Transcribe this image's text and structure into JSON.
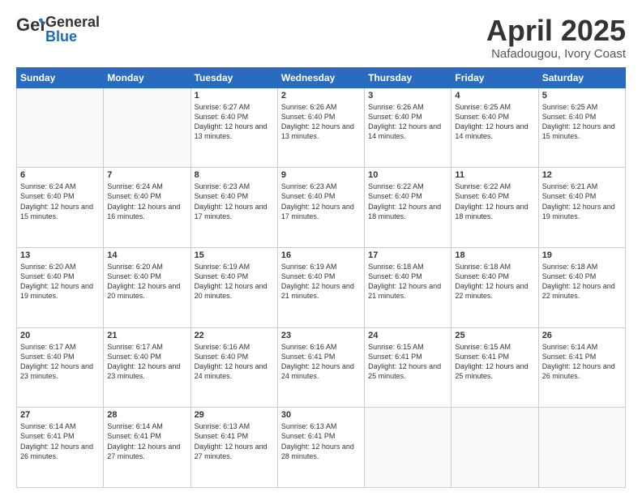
{
  "header": {
    "logo_general": "General",
    "logo_blue": "Blue",
    "month_title": "April 2025",
    "location": "Nafadougou, Ivory Coast"
  },
  "weekdays": [
    "Sunday",
    "Monday",
    "Tuesday",
    "Wednesday",
    "Thursday",
    "Friday",
    "Saturday"
  ],
  "weeks": [
    [
      {
        "day": "",
        "info": ""
      },
      {
        "day": "",
        "info": ""
      },
      {
        "day": "1",
        "info": "Sunrise: 6:27 AM\nSunset: 6:40 PM\nDaylight: 12 hours and 13 minutes."
      },
      {
        "day": "2",
        "info": "Sunrise: 6:26 AM\nSunset: 6:40 PM\nDaylight: 12 hours and 13 minutes."
      },
      {
        "day": "3",
        "info": "Sunrise: 6:26 AM\nSunset: 6:40 PM\nDaylight: 12 hours and 14 minutes."
      },
      {
        "day": "4",
        "info": "Sunrise: 6:25 AM\nSunset: 6:40 PM\nDaylight: 12 hours and 14 minutes."
      },
      {
        "day": "5",
        "info": "Sunrise: 6:25 AM\nSunset: 6:40 PM\nDaylight: 12 hours and 15 minutes."
      }
    ],
    [
      {
        "day": "6",
        "info": "Sunrise: 6:24 AM\nSunset: 6:40 PM\nDaylight: 12 hours and 15 minutes."
      },
      {
        "day": "7",
        "info": "Sunrise: 6:24 AM\nSunset: 6:40 PM\nDaylight: 12 hours and 16 minutes."
      },
      {
        "day": "8",
        "info": "Sunrise: 6:23 AM\nSunset: 6:40 PM\nDaylight: 12 hours and 17 minutes."
      },
      {
        "day": "9",
        "info": "Sunrise: 6:23 AM\nSunset: 6:40 PM\nDaylight: 12 hours and 17 minutes."
      },
      {
        "day": "10",
        "info": "Sunrise: 6:22 AM\nSunset: 6:40 PM\nDaylight: 12 hours and 18 minutes."
      },
      {
        "day": "11",
        "info": "Sunrise: 6:22 AM\nSunset: 6:40 PM\nDaylight: 12 hours and 18 minutes."
      },
      {
        "day": "12",
        "info": "Sunrise: 6:21 AM\nSunset: 6:40 PM\nDaylight: 12 hours and 19 minutes."
      }
    ],
    [
      {
        "day": "13",
        "info": "Sunrise: 6:20 AM\nSunset: 6:40 PM\nDaylight: 12 hours and 19 minutes."
      },
      {
        "day": "14",
        "info": "Sunrise: 6:20 AM\nSunset: 6:40 PM\nDaylight: 12 hours and 20 minutes."
      },
      {
        "day": "15",
        "info": "Sunrise: 6:19 AM\nSunset: 6:40 PM\nDaylight: 12 hours and 20 minutes."
      },
      {
        "day": "16",
        "info": "Sunrise: 6:19 AM\nSunset: 6:40 PM\nDaylight: 12 hours and 21 minutes."
      },
      {
        "day": "17",
        "info": "Sunrise: 6:18 AM\nSunset: 6:40 PM\nDaylight: 12 hours and 21 minutes."
      },
      {
        "day": "18",
        "info": "Sunrise: 6:18 AM\nSunset: 6:40 PM\nDaylight: 12 hours and 22 minutes."
      },
      {
        "day": "19",
        "info": "Sunrise: 6:18 AM\nSunset: 6:40 PM\nDaylight: 12 hours and 22 minutes."
      }
    ],
    [
      {
        "day": "20",
        "info": "Sunrise: 6:17 AM\nSunset: 6:40 PM\nDaylight: 12 hours and 23 minutes."
      },
      {
        "day": "21",
        "info": "Sunrise: 6:17 AM\nSunset: 6:40 PM\nDaylight: 12 hours and 23 minutes."
      },
      {
        "day": "22",
        "info": "Sunrise: 6:16 AM\nSunset: 6:40 PM\nDaylight: 12 hours and 24 minutes."
      },
      {
        "day": "23",
        "info": "Sunrise: 6:16 AM\nSunset: 6:41 PM\nDaylight: 12 hours and 24 minutes."
      },
      {
        "day": "24",
        "info": "Sunrise: 6:15 AM\nSunset: 6:41 PM\nDaylight: 12 hours and 25 minutes."
      },
      {
        "day": "25",
        "info": "Sunrise: 6:15 AM\nSunset: 6:41 PM\nDaylight: 12 hours and 25 minutes."
      },
      {
        "day": "26",
        "info": "Sunrise: 6:14 AM\nSunset: 6:41 PM\nDaylight: 12 hours and 26 minutes."
      }
    ],
    [
      {
        "day": "27",
        "info": "Sunrise: 6:14 AM\nSunset: 6:41 PM\nDaylight: 12 hours and 26 minutes."
      },
      {
        "day": "28",
        "info": "Sunrise: 6:14 AM\nSunset: 6:41 PM\nDaylight: 12 hours and 27 minutes."
      },
      {
        "day": "29",
        "info": "Sunrise: 6:13 AM\nSunset: 6:41 PM\nDaylight: 12 hours and 27 minutes."
      },
      {
        "day": "30",
        "info": "Sunrise: 6:13 AM\nSunset: 6:41 PM\nDaylight: 12 hours and 28 minutes."
      },
      {
        "day": "",
        "info": ""
      },
      {
        "day": "",
        "info": ""
      },
      {
        "day": "",
        "info": ""
      }
    ]
  ]
}
